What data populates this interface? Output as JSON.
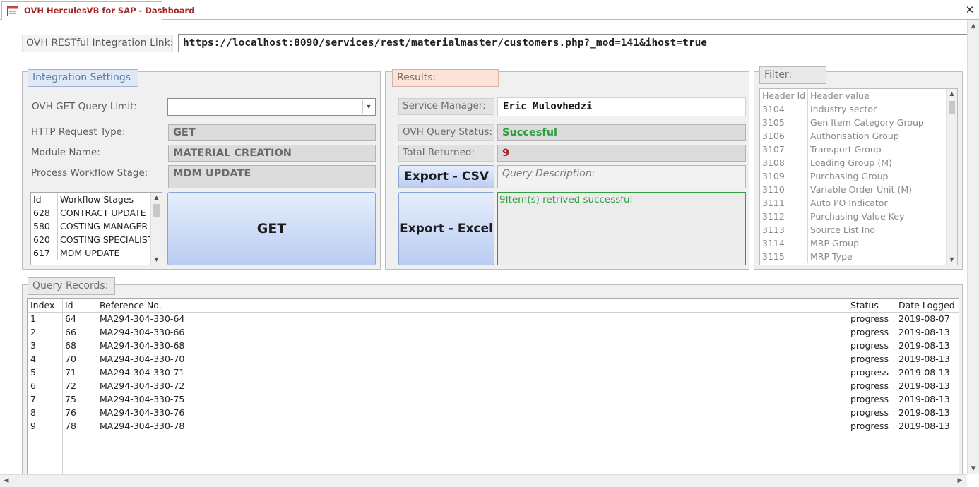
{
  "window": {
    "tab_title": "OVH HerculesVB for SAP - Dashboard",
    "close_symbol": "✕",
    "tab_icon": "form-icon"
  },
  "link": {
    "label": "OVH RESTful Integration Link:",
    "value": "https://localhost:8090/services/rest/materialmaster/customers.php?_mod=141&ihost=true"
  },
  "integration": {
    "legend": "Integration Settings",
    "query_limit_label": "OVH GET Query Limit:",
    "query_limit_value": "",
    "request_type_label": "HTTP Request Type:",
    "request_type_value": "GET",
    "module_label": "Module Name:",
    "module_value": "MATERIAL CREATION",
    "stage_label": "Process Workflow Stage:",
    "stage_value": "MDM UPDATE",
    "get_button": "GET",
    "workflow_list": {
      "headers": [
        "Id",
        "Workflow Stages"
      ],
      "rows": [
        [
          "628",
          "CONTRACT UPDATE"
        ],
        [
          "580",
          "COSTING MANAGER"
        ],
        [
          "620",
          "COSTING SPECIALIST"
        ],
        [
          "617",
          "MDM UPDATE"
        ]
      ]
    }
  },
  "results": {
    "legend": "Results:",
    "service_manager_label": "Service Manager:",
    "service_manager_value": "Eric Mulovhedzi",
    "status_label": "OVH Query Status:",
    "status_value": "Succesful",
    "total_label": "Total Returned:",
    "total_value": "9",
    "export_csv": "Export - CSV",
    "export_excel": "Export - Excel",
    "description_placeholder": "Query Description:",
    "message": "9Item(s) retrived successful",
    "colors": {
      "status": "#2e9e3e",
      "total": "#b01c1c",
      "message": "#2e9e3e"
    }
  },
  "filter": {
    "legend": "Filter:",
    "headers": [
      "Header Id",
      "Header value"
    ],
    "rows": [
      [
        "3104",
        "Industry sector"
      ],
      [
        "3105",
        "Gen Item Category Group"
      ],
      [
        "3106",
        "Authorisation Group"
      ],
      [
        "3107",
        "Transport Group"
      ],
      [
        "3108",
        "Loading Group (M)"
      ],
      [
        "3109",
        "Purchasing Group"
      ],
      [
        "3110",
        "Variable Order Unit (M)"
      ],
      [
        "3111",
        "Auto PO Indicator"
      ],
      [
        "3112",
        "Purchasing Value Key"
      ],
      [
        "3113",
        "Source List Ind"
      ],
      [
        "3114",
        "MRP Group"
      ],
      [
        "3115",
        "MRP Type"
      ]
    ]
  },
  "records": {
    "legend": "Query Records:",
    "headers": [
      "Index",
      "Id",
      "Reference No.",
      "Status",
      "Date Logged"
    ],
    "rows": [
      [
        "1",
        "64",
        "MA294-304-330-64",
        "progress",
        "2019-08-07"
      ],
      [
        "2",
        "66",
        "MA294-304-330-66",
        "progress",
        "2019-08-13"
      ],
      [
        "3",
        "68",
        "MA294-304-330-68",
        "progress",
        "2019-08-13"
      ],
      [
        "4",
        "70",
        "MA294-304-330-70",
        "progress",
        "2019-08-13"
      ],
      [
        "5",
        "71",
        "MA294-304-330-71",
        "progress",
        "2019-08-13"
      ],
      [
        "6",
        "72",
        "MA294-304-330-72",
        "progress",
        "2019-08-13"
      ],
      [
        "7",
        "75",
        "MA294-304-330-75",
        "progress",
        "2019-08-13"
      ],
      [
        "8",
        "76",
        "MA294-304-330-76",
        "progress",
        "2019-08-13"
      ],
      [
        "9",
        "78",
        "MA294-304-330-78",
        "progress",
        "2019-08-13"
      ]
    ]
  }
}
